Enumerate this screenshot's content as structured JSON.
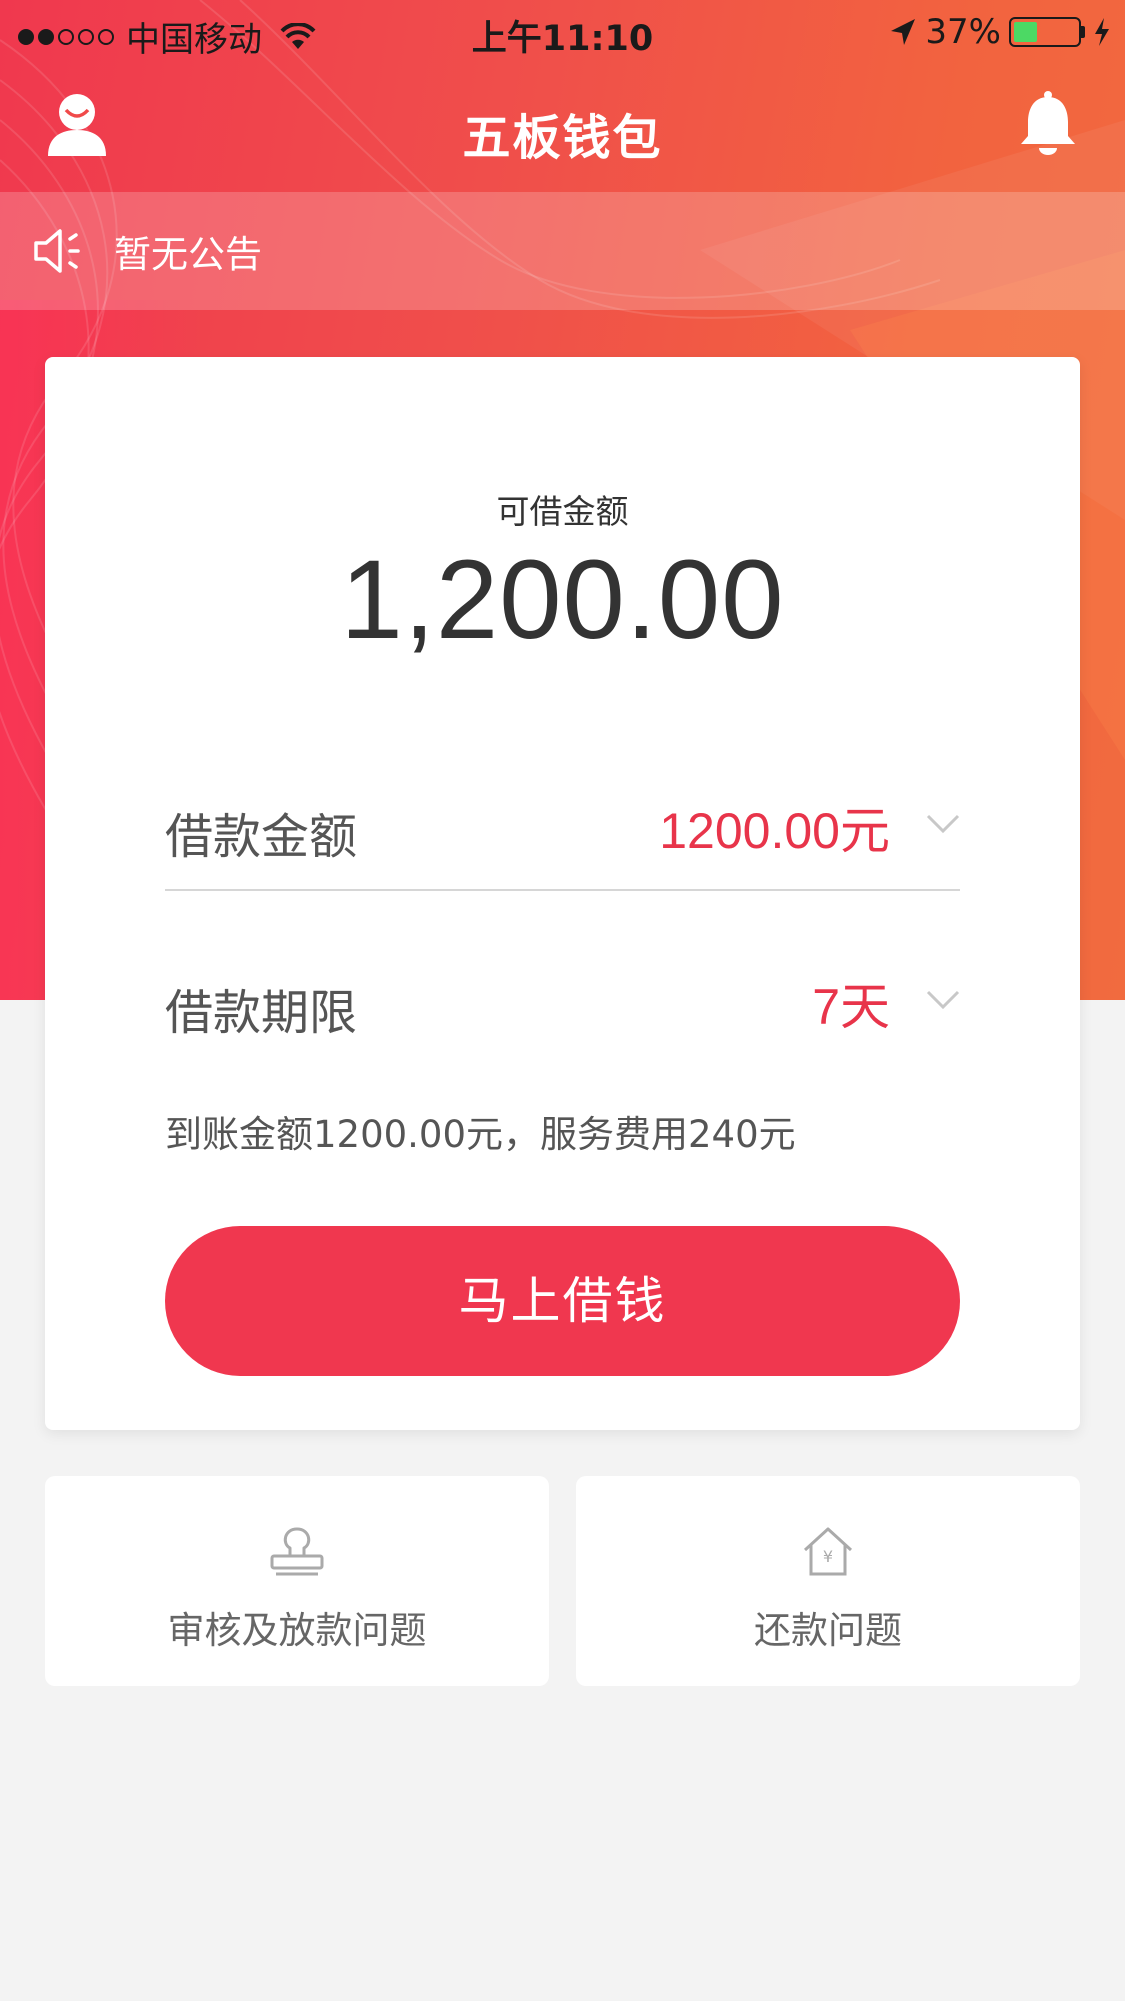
{
  "status_bar": {
    "carrier": "中国移动",
    "time": "上午11:10",
    "battery_percent": "37%",
    "battery_level": 0.37
  },
  "nav": {
    "title": "五板钱包",
    "profile_icon": "user-icon",
    "notification_icon": "bell-icon"
  },
  "notice": {
    "icon": "speaker-icon",
    "text": "暂无公告"
  },
  "loan_card": {
    "available_label": "可借金额",
    "available_amount": "1,200.00",
    "amount_row": {
      "label": "借款金额",
      "value": "1200.00元"
    },
    "term_row": {
      "label": "借款期限",
      "value": "7天"
    },
    "fee_summary": "到账金额1200.00元，服务费用240元",
    "submit_label": "马上借钱"
  },
  "help_tiles": [
    {
      "icon": "stamp-icon",
      "label": "审核及放款问题"
    },
    {
      "icon": "house-yen-icon",
      "label": "还款问题"
    }
  ],
  "colors": {
    "brand_red": "#f0374f",
    "value_red": "#e8344a",
    "page_bg": "#f3f3f3"
  }
}
